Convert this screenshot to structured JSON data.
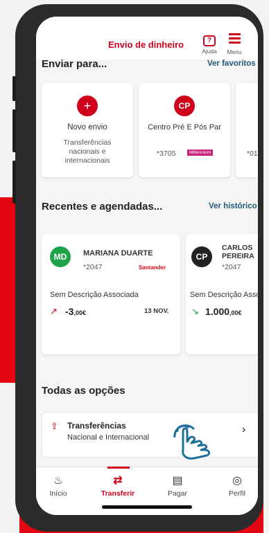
{
  "colors": {
    "brand_red": "#d0021b",
    "link_blue": "#1f5a7a",
    "green_avatar": "#1fa34a"
  },
  "header": {
    "title": "Envio de dinheiro",
    "help_label": "Ajuda",
    "menu_label": "Menu",
    "help_glyph": "?"
  },
  "send_to": {
    "title": "Enviar para...",
    "link": "Ver favoritos",
    "cards": [
      {
        "avatar": "+",
        "name": "Novo envio",
        "desc_lines": [
          "Transferências",
          "nacionais e",
          "internacionais"
        ]
      },
      {
        "avatar": "CP",
        "name": "Centro Pré E Pós Par",
        "account": "*3705",
        "bank": "Millennium"
      },
      {
        "account": "*01"
      }
    ]
  },
  "recent": {
    "title": "Recentes e agendadas...",
    "link": "Ver histórico",
    "cards": [
      {
        "avatar": "MD",
        "name": "MARIANA DUARTE",
        "account": "*2047",
        "bank": "Santander",
        "desc": "Sem Descrição Associada",
        "amount_main": "-3",
        "amount_dec": ",00€",
        "date": "13 NOV."
      },
      {
        "avatar": "CP",
        "name_lines": [
          "CARLOS",
          "PEREIRA"
        ],
        "account": "*2047",
        "desc": "Sem Descrição Asso",
        "amount_main": "1.000",
        "amount_dec": ",00€"
      }
    ]
  },
  "options": {
    "title": "Todas as opções",
    "items": [
      {
        "label": "Transferências",
        "sub": "Nacional e Internacional"
      }
    ]
  },
  "nav": [
    {
      "label": "Início",
      "icon": "home-icon"
    },
    {
      "label": "Transferir",
      "icon": "transfer-icon",
      "active": true
    },
    {
      "label": "Pagar",
      "icon": "pay-icon"
    },
    {
      "label": "Perfil",
      "icon": "profile-icon"
    }
  ]
}
